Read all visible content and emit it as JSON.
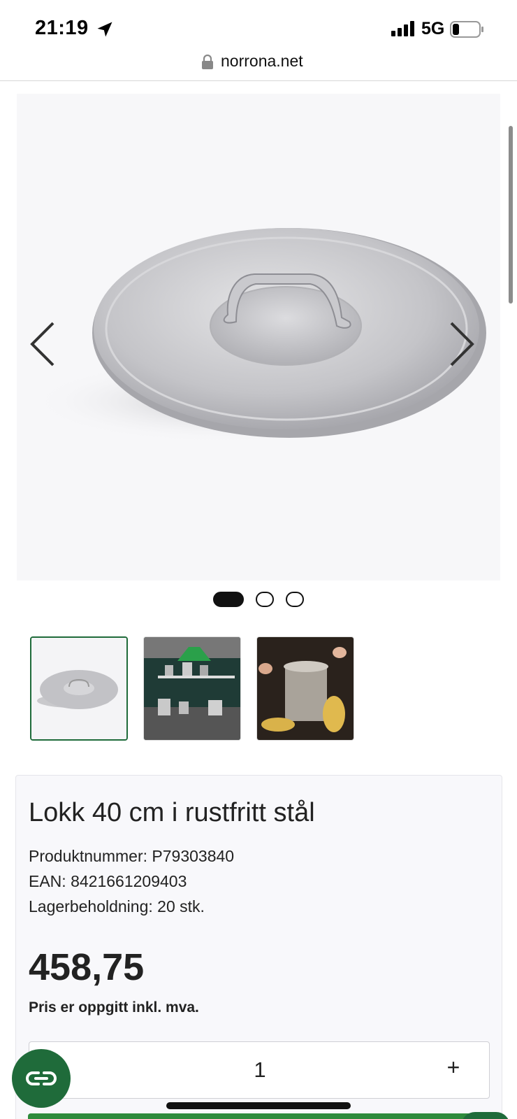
{
  "status_bar": {
    "time": "21:19",
    "network": "5G",
    "icons": [
      "location-arrow-icon",
      "signal-bars-icon",
      "battery-icon"
    ]
  },
  "browser": {
    "url": "norrona.net",
    "icons": [
      "lock-icon"
    ]
  },
  "gallery": {
    "image_count": 3,
    "active_index": 0,
    "icons": [
      "chevron-left-icon",
      "chevron-right-icon"
    ]
  },
  "product": {
    "title": "Lokk 40 cm i rustfritt stål",
    "product_number": "Produktnummer: P79303840",
    "ean": "EAN: 8421661209403",
    "stock": "Lagerbeholdning: 20 stk.",
    "price": "458,75",
    "price_note": "Pris er oppgitt inkl. mva.",
    "quantity": "1",
    "plus_label": "+"
  },
  "colors": {
    "brand_green": "#1f6b3a",
    "text": "#222222",
    "card_bg": "#f8f8fb"
  }
}
